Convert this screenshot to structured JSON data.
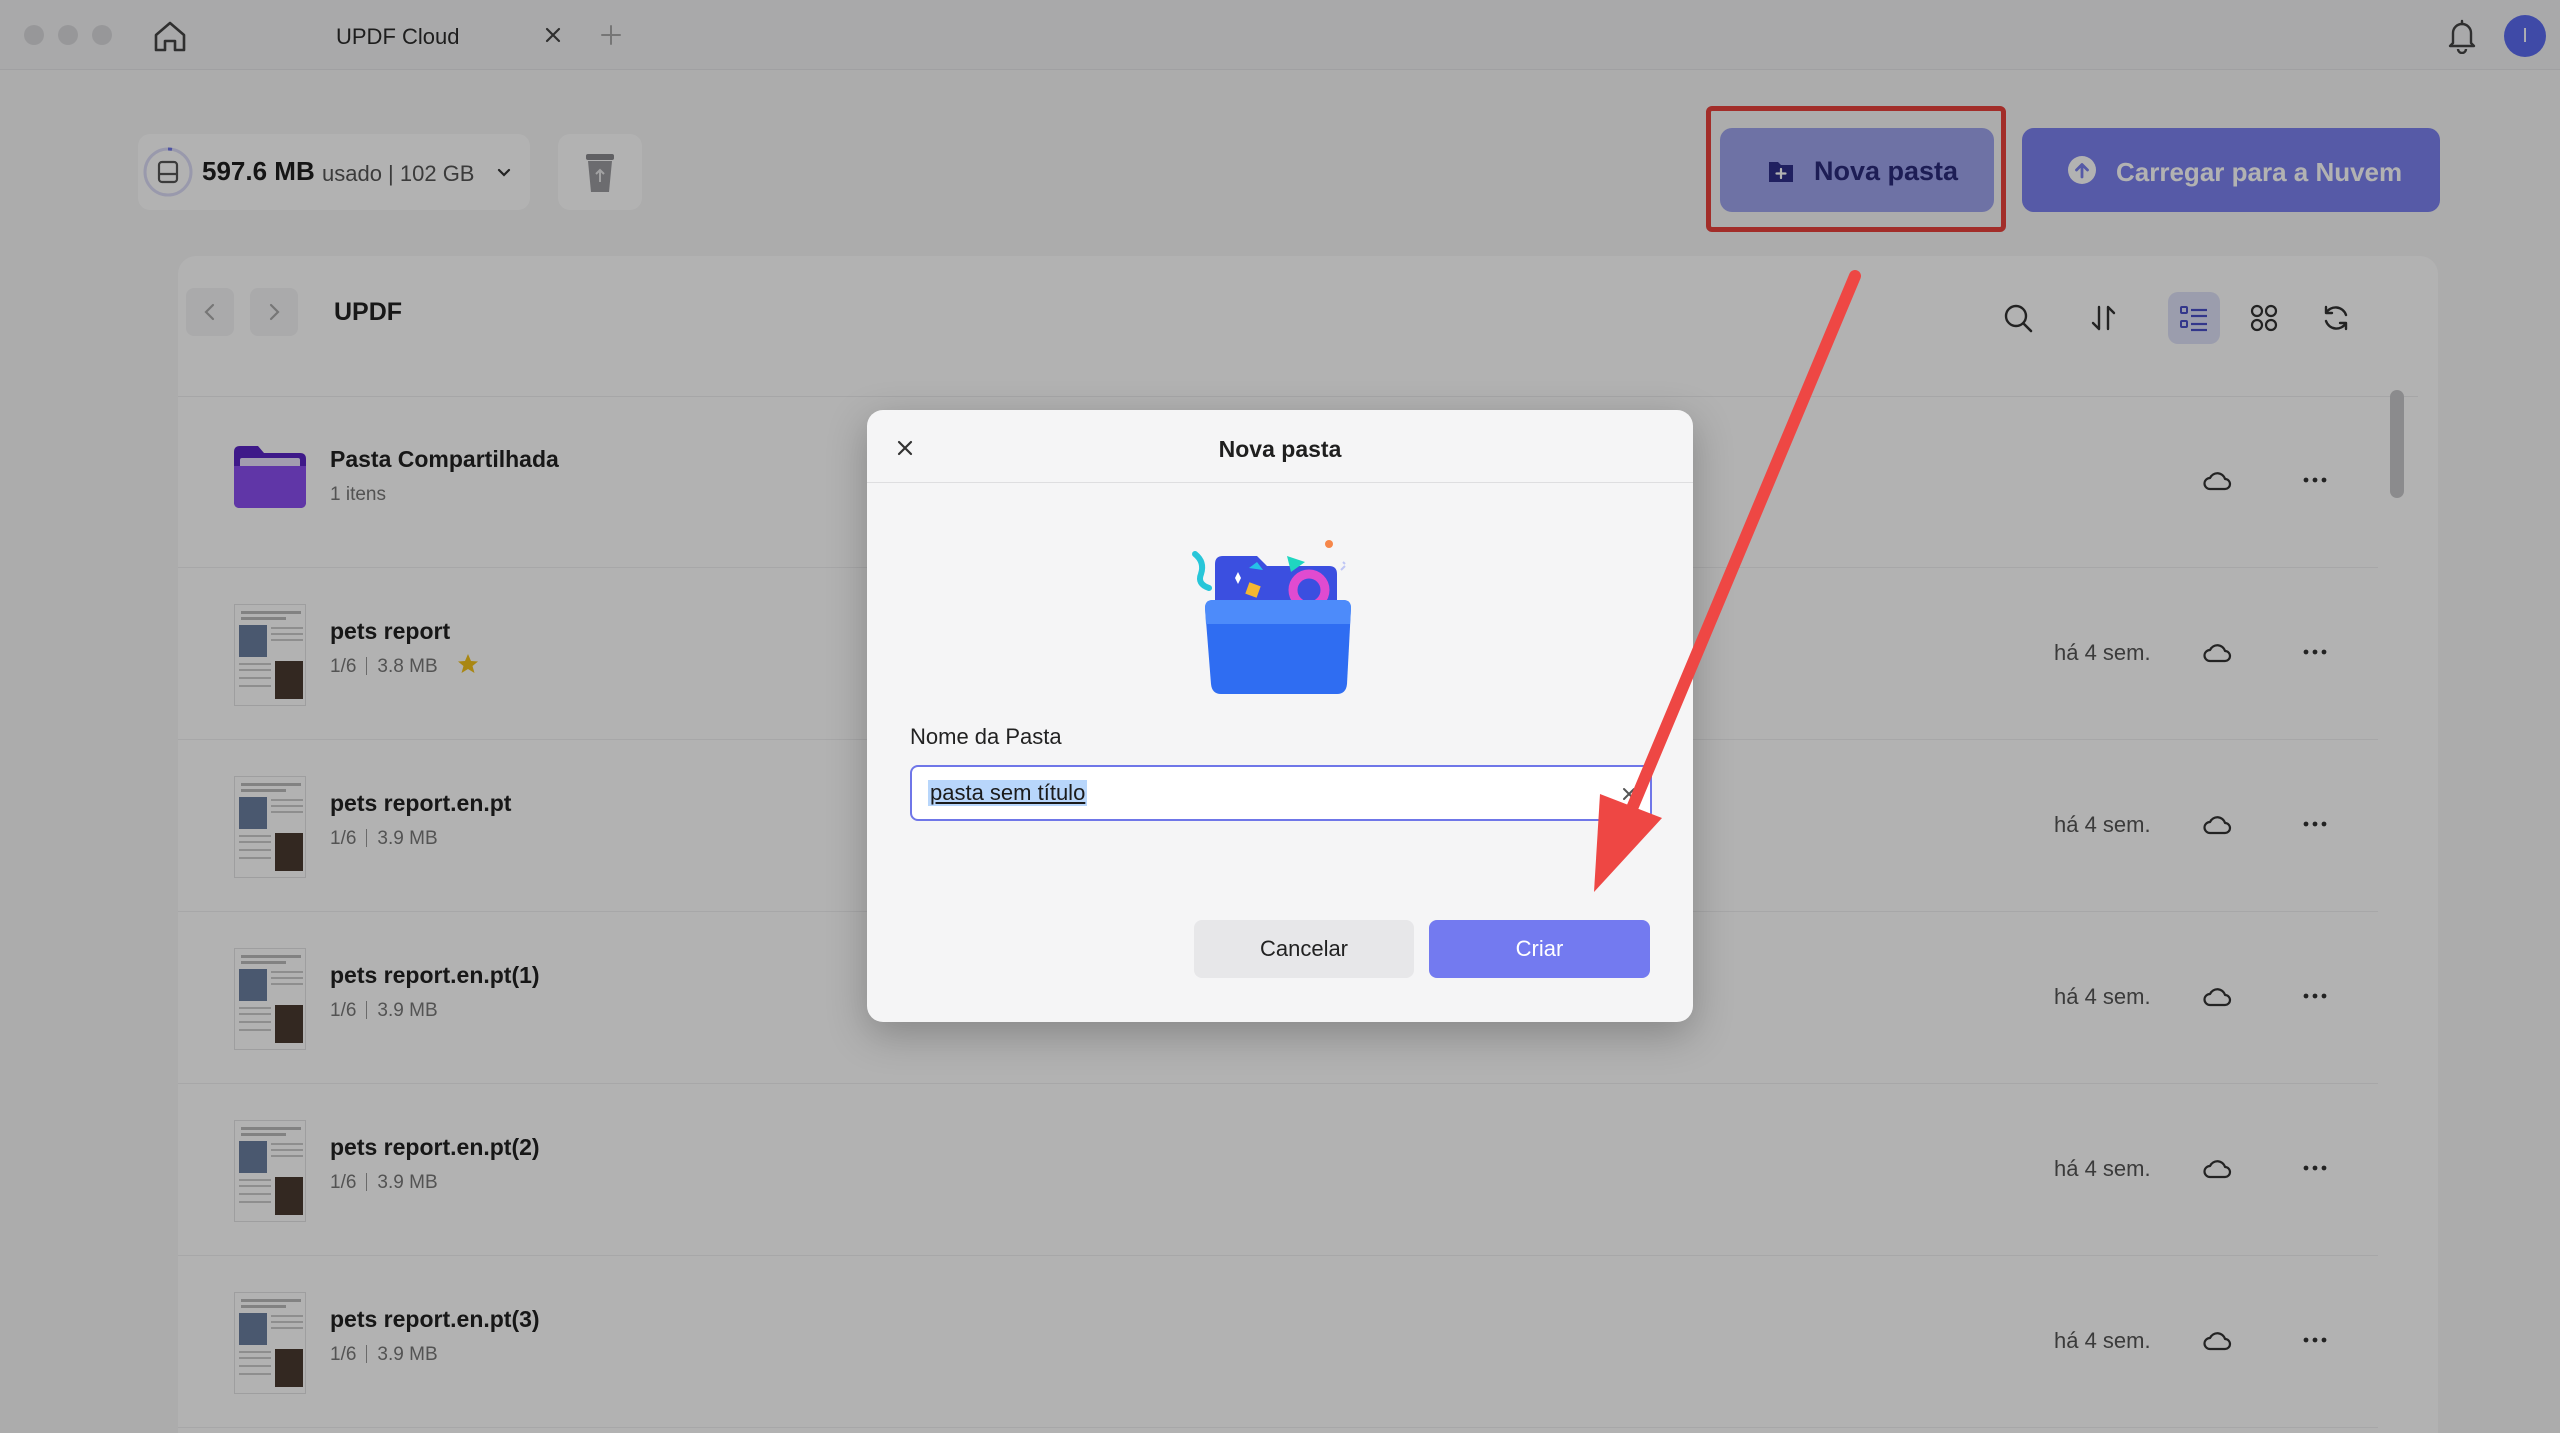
{
  "titlebar": {
    "tab_title": "UPDF Cloud",
    "avatar_initial": "I"
  },
  "header": {
    "storage_used": "597.6 MB",
    "storage_total": "usado | 102 GB",
    "new_folder_label": "Nova pasta",
    "upload_label": "Carregar para a Nuvem"
  },
  "browser": {
    "breadcrumb": "UPDF",
    "items": [
      {
        "name": "Pasta Compartilhada",
        "meta_a": "1 itens",
        "meta_b": "",
        "date": "",
        "type": "folder"
      },
      {
        "name": "pets report",
        "meta_a": "1/6",
        "meta_b": "3.8 MB",
        "date": "há 4 sem.",
        "type": "pdf",
        "starred": true
      },
      {
        "name": "pets report.en.pt",
        "meta_a": "1/6",
        "meta_b": "3.9 MB",
        "date": "há 4 sem.",
        "type": "pdf"
      },
      {
        "name": "pets report.en.pt(1)",
        "meta_a": "1/6",
        "meta_b": "3.9 MB",
        "date": "há 4 sem.",
        "type": "pdf"
      },
      {
        "name": "pets report.en.pt(2)",
        "meta_a": "1/6",
        "meta_b": "3.9 MB",
        "date": "há 4 sem.",
        "type": "pdf"
      },
      {
        "name": "pets report.en.pt(3)",
        "meta_a": "1/6",
        "meta_b": "3.9 MB",
        "date": "há 4 sem.",
        "type": "pdf"
      }
    ]
  },
  "dialog": {
    "title": "Nova pasta",
    "field_label": "Nome da Pasta",
    "field_value": "pasta sem título",
    "cancel_label": "Cancelar",
    "create_label": "Criar"
  },
  "colors": {
    "accent": "#737af0",
    "highlight_frame": "#e8413c",
    "folder_purple": "#7b3fe4"
  },
  "icons": [
    "home-icon",
    "close-icon",
    "plus-icon",
    "bell-icon",
    "storage-icon",
    "chevron-down-icon",
    "trash-icon",
    "folder-plus-icon",
    "cloud-upload-icon",
    "chevron-left-icon",
    "chevron-right-icon",
    "search-icon",
    "sort-icon",
    "list-view-icon",
    "grid-view-icon",
    "refresh-icon",
    "folder-icon",
    "pdf-thumbnail",
    "star-icon",
    "cloud-icon",
    "more-icon"
  ]
}
